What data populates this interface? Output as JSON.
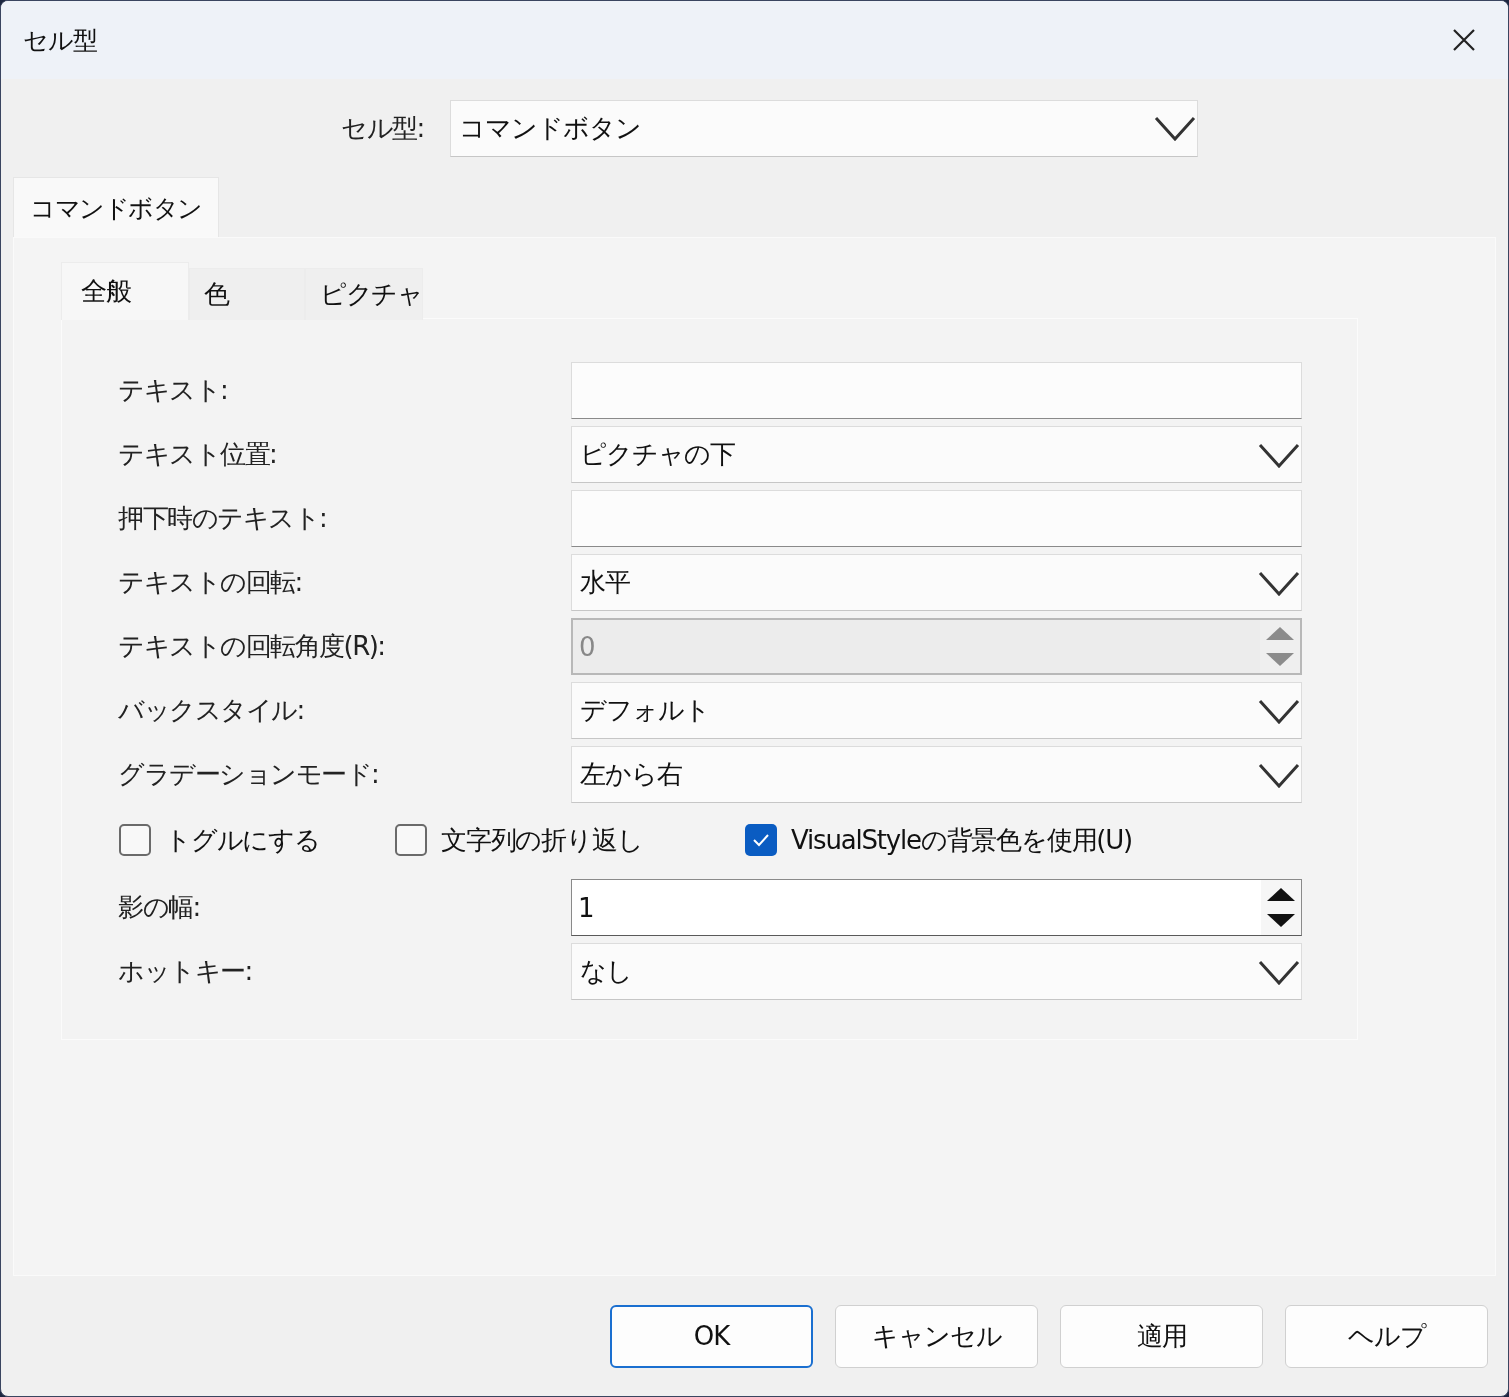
{
  "window": {
    "title": "セル型"
  },
  "cell_type": {
    "label": "セル型:",
    "value": "コマンドボタン"
  },
  "outer_tabs": [
    {
      "label": "コマンドボタン",
      "selected": true
    }
  ],
  "inner_tabs": [
    {
      "label": "全般",
      "selected": true
    },
    {
      "label": "色",
      "selected": false
    },
    {
      "label": "ピクチャ",
      "selected": false
    }
  ],
  "fields": [
    {
      "kind": "text",
      "label": "テキスト:"
    },
    {
      "kind": "combo",
      "label": "テキスト位置:",
      "value": "ピクチャの下"
    },
    {
      "kind": "text",
      "label": "押下時のテキスト:"
    },
    {
      "kind": "combo",
      "label": "テキストの回転:",
      "value": "水平"
    },
    {
      "kind": "spin",
      "label": "テキストの回転角度(R):",
      "value": "0",
      "disabled": true
    },
    {
      "kind": "combo",
      "label": "バックスタイル:",
      "value": "デフォルト"
    },
    {
      "kind": "combo",
      "label": "グラデーションモード:",
      "value": "左から右"
    }
  ],
  "checkboxes": [
    {
      "label": "トグルにする",
      "checked": false
    },
    {
      "label": "文字列の折り返し",
      "checked": false
    },
    {
      "label": "VisualStyleの背景色を使用(U)",
      "checked": true
    }
  ],
  "fields_2": [
    {
      "kind": "spin",
      "label": "影の幅:",
      "value": "1",
      "disabled": false
    },
    {
      "kind": "combo",
      "label": "ホットキー:",
      "value": "なし"
    }
  ],
  "buttons": [
    {
      "label": "OK",
      "default": true
    },
    {
      "label": "キャンセル",
      "default": false
    },
    {
      "label": "適用",
      "default": false
    },
    {
      "label": "ヘルプ",
      "default": false
    }
  ]
}
